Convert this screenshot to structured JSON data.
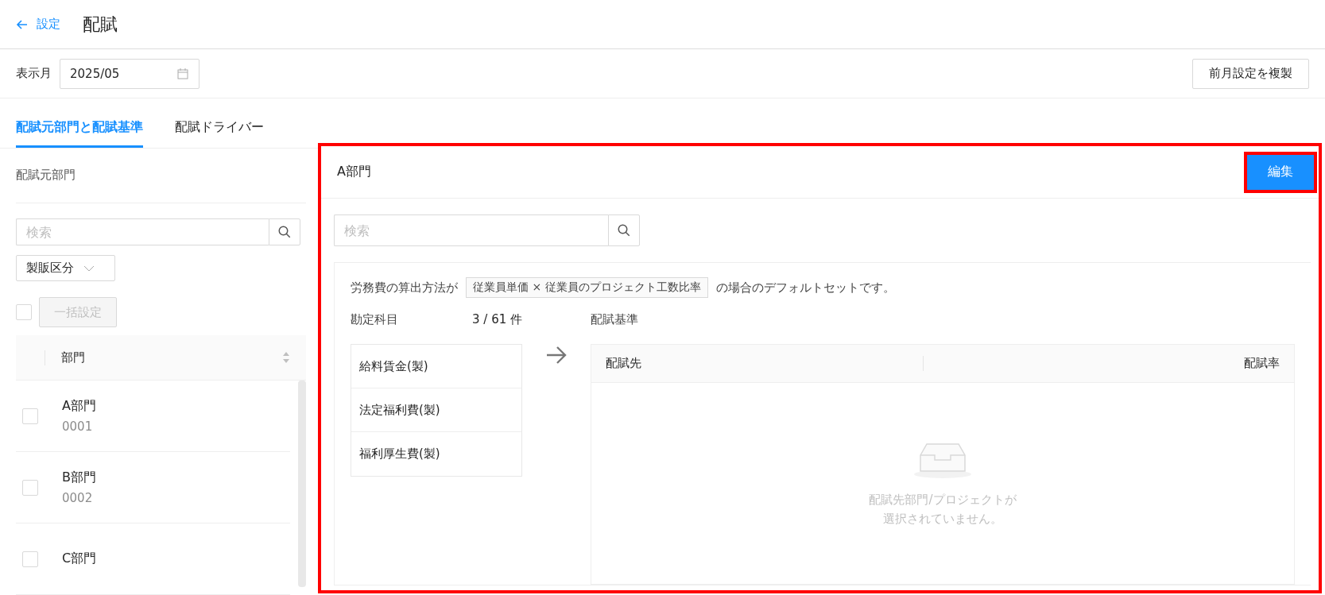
{
  "header": {
    "back_label": "設定",
    "title": "配賦"
  },
  "toolbar": {
    "month_label": "表示月",
    "month_value": "2025/05",
    "copy_button": "前月設定を複製"
  },
  "tabs": [
    {
      "label": "配賦元部門と配賦基準",
      "selected": true
    },
    {
      "label": "配賦ドライバー",
      "selected": false
    }
  ],
  "sidebar": {
    "title": "配賦元部門",
    "search": {
      "placeholder": "検索"
    },
    "filter": "製販区分",
    "select_all_checked": false,
    "bulk_button": "一括設定",
    "bulk_disabled": true,
    "table": {
      "column": "部門",
      "rows": [
        {
          "name": "A部門",
          "code": "0001",
          "checked": false
        },
        {
          "name": "B部門",
          "code": "0002",
          "checked": false
        },
        {
          "name": "C部門",
          "code": "",
          "checked": false
        }
      ]
    }
  },
  "detail": {
    "highlighted": true,
    "title": "A部門",
    "edit_button": "編集",
    "edit_highlighted": true,
    "search": {
      "placeholder": "検索"
    },
    "description_before": "労務費の算出方法が",
    "method_tag": "従業員単価 × 従業員のプロジェクト工数比率",
    "description_after": "の場合のデフォルトセットです。",
    "accounts_label": "勘定科目",
    "accounts_count": "3 / 61 件",
    "accounts": [
      "給料賃金(製)",
      "法定福利費(製)",
      "福利厚生費(製)"
    ],
    "basis_label": "配賦基準",
    "basis_columns": [
      "配賦先",
      "配賦率"
    ],
    "empty_text": [
      "配賦先部門/プロジェクトが",
      "選択されていません。"
    ]
  }
}
